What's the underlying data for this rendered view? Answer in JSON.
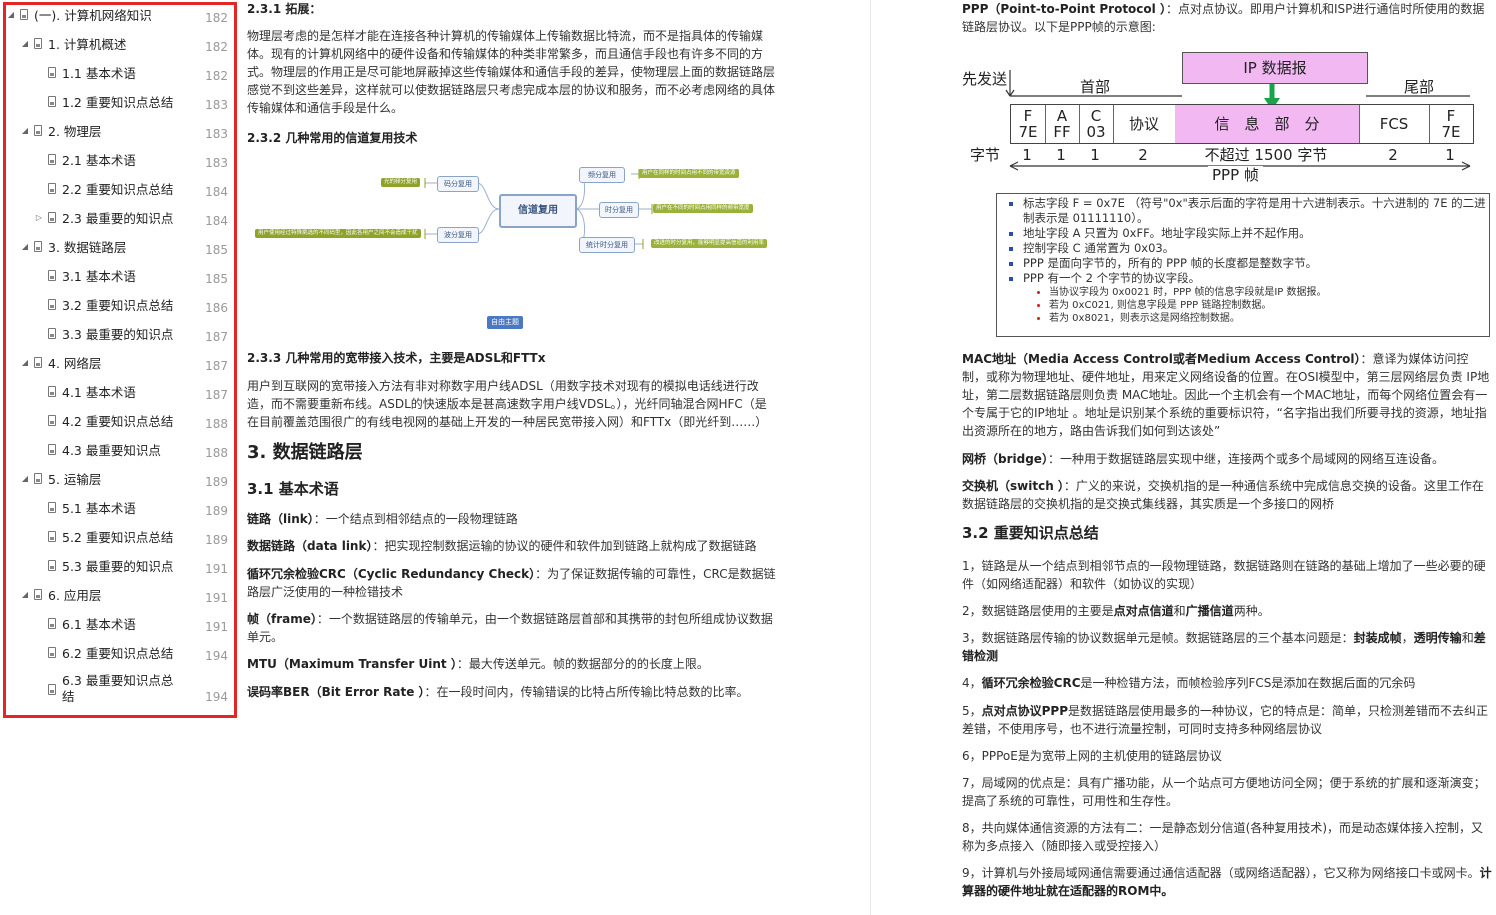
{
  "toc": [
    {
      "label": "(一). 计算机网络知识",
      "page": "182",
      "level": 0,
      "arrow": "◢"
    },
    {
      "label": "1. 计算机概述",
      "page": "182",
      "level": 1,
      "arrow": "◢"
    },
    {
      "label": "1.1 基本术语",
      "page": "182",
      "level": 2,
      "arrow": ""
    },
    {
      "label": "1.2 重要知识点总结",
      "page": "183",
      "level": 2,
      "arrow": ""
    },
    {
      "label": "2. 物理层",
      "page": "183",
      "level": 1,
      "arrow": "◢"
    },
    {
      "label": "2.1 基本术语",
      "page": "183",
      "level": 2,
      "arrow": ""
    },
    {
      "label": "2.2 重要知识点总结",
      "page": "184",
      "level": 2,
      "arrow": ""
    },
    {
      "label": "2.3 最重要的知识点",
      "page": "184",
      "level": 2,
      "arrow": "▷"
    },
    {
      "label": "3. 数据链路层",
      "page": "185",
      "level": 1,
      "arrow": "◢"
    },
    {
      "label": "3.1 基本术语",
      "page": "185",
      "level": 2,
      "arrow": ""
    },
    {
      "label": "3.2 重要知识点总结",
      "page": "186",
      "level": 2,
      "arrow": ""
    },
    {
      "label": "3.3 最重要的知识点",
      "page": "187",
      "level": 2,
      "arrow": ""
    },
    {
      "label": "4. 网络层",
      "page": "187",
      "level": 1,
      "arrow": "◢"
    },
    {
      "label": "4.1 基本术语",
      "page": "187",
      "level": 2,
      "arrow": ""
    },
    {
      "label": "4.2 重要知识点总结",
      "page": "188",
      "level": 2,
      "arrow": ""
    },
    {
      "label": "4.3 最重要知识点",
      "page": "188",
      "level": 2,
      "arrow": ""
    },
    {
      "label": "5. 运输层",
      "page": "189",
      "level": 1,
      "arrow": "◢"
    },
    {
      "label": "5.1 基本术语",
      "page": "189",
      "level": 2,
      "arrow": ""
    },
    {
      "label": "5.2 重要知识点总结",
      "page": "189",
      "level": 2,
      "arrow": ""
    },
    {
      "label": "5.3 最重要的知识点",
      "page": "191",
      "level": 2,
      "arrow": ""
    },
    {
      "label": "6. 应用层",
      "page": "191",
      "level": 1,
      "arrow": "◢"
    },
    {
      "label": "6.1 基本术语",
      "page": "191",
      "level": 2,
      "arrow": ""
    },
    {
      "label": "6.2 重要知识点总结",
      "page": "194",
      "level": 2,
      "arrow": ""
    },
    {
      "label": "6.3 最重要知识点总结",
      "page": "194",
      "level": 2,
      "arrow": ""
    }
  ],
  "mid": {
    "h_231": "2.3.1 拓展：",
    "p_231": "物理层考虑的是怎样才能在连接各种计算机的传输媒体上传输数据比特流，而不是指具体的传输媒体。现有的计算机网络中的硬件设备和传输媒体的种类非常繁多，而且通信手段也有许多不同的方式。物理层的作用正是尽可能地屏蔽掉这些传输媒体和通信手段的差异，使物理层上面的数据链路层感觉不到这些差异，这样就可以使数据链路层只考虑完成本层的协议和服务，而不必考虑网络的具体传输媒体和通信手段是什么。",
    "h_232": "2.3.2 几种常用的信道复用技术",
    "mm_center": "信道复用",
    "mm_code": "码分复用",
    "mm_wave": "波分复用",
    "mm_freq": "频分复用",
    "mm_time": "时分复用",
    "mm_stat": "统计时分复用",
    "mm_leaf_code": "光的频分复用",
    "mm_leaf_wave": "用户使用经过特殊挑选的不同码型，因此各用户之间不会造成干扰",
    "mm_leaf_freq": "用户在同样的时间占用不同的带宽资源",
    "mm_leaf_time": "用户在不同的时间占用同样的频带宽度",
    "mm_leaf_stat": "改进的时分复用，能够明显提高信道的利用率",
    "mm_free": "自由主题",
    "h_233": "2.3.3 几种常用的宽带接入技术，主要是ADSL和FTTx",
    "p_233": "用户到互联网的宽带接入方法有非对称数字用户线ADSL（用数字技术对现有的模拟电话线进行改造，而不需要重新布线。ASDL的快速版本是甚高速数字用户线VDSL。），光纤同轴混合网HFC（是在目前覆盖范围很广的有线电视网的基础上开发的一种居民宽带接入网）和FTTx（即光纤到……）",
    "h_3": "3. 数据链路层",
    "h_31": "3.1 基本术语",
    "t1_b": "链路（link）",
    "t1": "：一个结点到相邻结点的一段物理链路",
    "t2_b": "数据链路（data link）",
    "t2": "：把实现控制数据运输的协议的硬件和软件加到链路上就构成了数据链路",
    "t3_b": "循环冗余检验CRC（Cyclic Redundancy Check）",
    "t3": "：为了保证数据传输的可靠性，CRC是数据链路层广泛使用的一种检错技术",
    "t4_b": "帧（frame）",
    "t4": "：一个数据链路层的传输单元，由一个数据链路层首部和其携带的封包所组成协议数据单元。",
    "t5_b": "MTU（Maximum Transfer Uint ）",
    "t5": "：最大传送单元。帧的数据部分的的长度上限。",
    "t6_b": "误码率BER（Bit Error Rate ）",
    "t6": "：在一段时间内，传输错误的比特占所传输比特总数的比率。"
  },
  "right": {
    "ppp_b": "PPP（Point-to-Point Protocol ）",
    "ppp": "：点对点协议。即用户计算机和ISP进行通信时所使用的数据链路层协议。以下是PPP帧的示意图:",
    "fig_send": "先发送",
    "fig_head": "首部",
    "fig_tail": "尾部",
    "fig_ip": "IP 数据报",
    "fig_cells": [
      "F\n7E",
      "A\nFF",
      "C\n03",
      "协议",
      "信　息　部　分",
      "FCS",
      "F\n7E"
    ],
    "fig_bytes_label": "字节",
    "fig_bytes": [
      "1",
      "1",
      "1",
      "2",
      "不超过 1500 字节",
      "2",
      "1"
    ],
    "fig_frame": "PPP 帧",
    "note_items": [
      "标志字段 F = 0x7E （符号\"0x\"表示后面的字符是用十六进制表示。十六进制的 7E 的二进制表示是 01111110）。",
      "地址字段 A 只置为 0xFF。地址字段实际上并不起作用。",
      "控制字段 C 通常置为 0x03。",
      "PPP 是面向字节的，所有的 PPP 帧的长度都是整数字节。",
      "PPP 有一个 2 个字节的协议字段。"
    ],
    "note_sub": [
      "当协议字段为 0x0021 时，PPP 帧的信息字段就是IP 数据报。",
      "若为 0xC021, 则信息字段是 PPP 链路控制数据。",
      "若为 0x8021，则表示这是网络控制数据。"
    ],
    "mac_b": "MAC地址（Media Access Control或者Medium Access Control）",
    "mac": "：意译为媒体访问控制，或称为物理地址、硬件地址，用来定义网络设备的位置。在OSI模型中，第三层网络层负责 IP地址，第二层数据链路层则负责 MAC地址。因此一个主机会有一个MAC地址，而每个网络位置会有一个专属于它的IP地址 。地址是识别某个系统的重要标识符，“名字指出我们所要寻找的资源，地址指出资源所在的地方，路由告诉我们如何到达该处”",
    "bridge_b": "网桥（bridge）",
    "bridge": "：一种用于数据链路层实现中继，连接两个或多个局域网的网络互连设备。",
    "switch_b": "交换机（switch ）",
    "switch": "：广义的来说，交换机指的是一种通信系统中完成信息交换的设备。这里工作在数据链路层的交换机指的是交换式集线器，其实质是一个多接口的网桥",
    "h_32": "3.2 重要知识点总结",
    "s1": "1，链路是从一个结点到相邻节点的一段物理链路，数据链路则在链路的基础上增加了一些必要的硬件（如网络适配器）和软件（如协议的实现）",
    "s2a": "2，数据链路层使用的主要是",
    "s2b": "点对点信道",
    "s2c": "和",
    "s2d": "广播信道",
    "s2e": "两种。",
    "s3a": "3，数据链路层传输的协议数据单元是帧。数据链路层的三个基本问题是：",
    "s3b": "封装成帧",
    "s3c": "，",
    "s3d": "透明传输",
    "s3e": "和",
    "s3f": "差错检测",
    "s4a": "4，",
    "s4b": "循环冗余检验CRC",
    "s4c": "是一种检错方法，而帧检验序列FCS是添加在数据后面的冗余码",
    "s5a": "5，",
    "s5b": "点对点协议PPP",
    "s5c": "是数据链路层使用最多的一种协议，它的特点是：简单，只检测差错而不去纠正差错，不使用序号，也不进行流量控制，可同时支持多种网络层协议",
    "s6": "6，PPPoE是为宽带上网的主机使用的链路层协议",
    "s7a": "7，局域网的优点是：具有广播功能，从一个站点可方便地访问全网；便于系统的扩展和逐渐演变；提高了系统的可靠性，可用性和生存性。",
    "s8": "8，共向媒体通信资源的方法有二：一是静态划分信道(各种复用技术)，而是动态媒体接入控制，又称为多点接入（随即接入或受控接入）",
    "s9a": "9，计算机与外接局域网通信需要通过通信适配器（或网络适配器），它又称为网络接口卡或网卡。",
    "s9b": "计算器的硬件地址就在适配器的ROM中。"
  }
}
